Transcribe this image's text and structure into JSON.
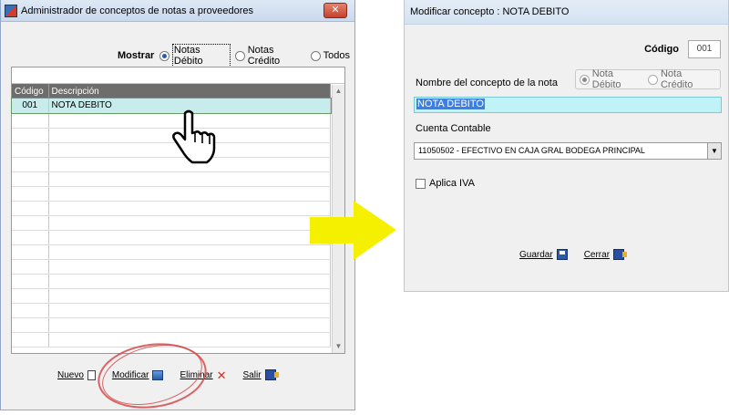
{
  "left_window": {
    "title": "Administrador de conceptos de notas a proveedores",
    "close_label": "✕",
    "mostrar": {
      "label": "Mostrar",
      "options": [
        "Notas Débito",
        "Notas Crédito",
        "Todos"
      ],
      "selected": "Notas Débito"
    },
    "grid": {
      "columns": [
        "Código",
        "Descripción"
      ],
      "rows": [
        {
          "codigo": "001",
          "descripcion": "NOTA DEBITO"
        }
      ]
    },
    "buttons": {
      "nuevo": "Nuevo",
      "modificar": "Modificar",
      "eliminar": "Eliminar",
      "salir": "Salir"
    }
  },
  "right_window": {
    "title": "Modificar concepto : NOTA DEBITO",
    "codigo_label": "Código",
    "codigo_value": "001",
    "tipo_options": [
      "Nota Débito",
      "Nota Crédito"
    ],
    "tipo_selected": "Nota Débito",
    "nombre_label": "Nombre del concepto de la nota",
    "nombre_value": "NOTA DEBITO",
    "cuenta_label": "Cuenta Contable",
    "cuenta_value": "11050502 - EFECTIVO EN CAJA GRAL BODEGA PRINCIPAL",
    "iva_label": "Aplica IVA",
    "iva_checked": false,
    "buttons": {
      "guardar": "Guardar",
      "cerrar": "Cerrar"
    }
  },
  "colors": {
    "arrow": "#f5f000",
    "highlight_circle": "#d24a4a",
    "selected_row": "#c8ecec",
    "name_field": "#bff3f8"
  },
  "icons": [
    "app-icon",
    "close-icon",
    "new-document-icon",
    "edit-icon",
    "delete-icon",
    "exit-door-icon",
    "save-disk-icon",
    "hand-pointer-icon",
    "arrow-right-icon"
  ]
}
